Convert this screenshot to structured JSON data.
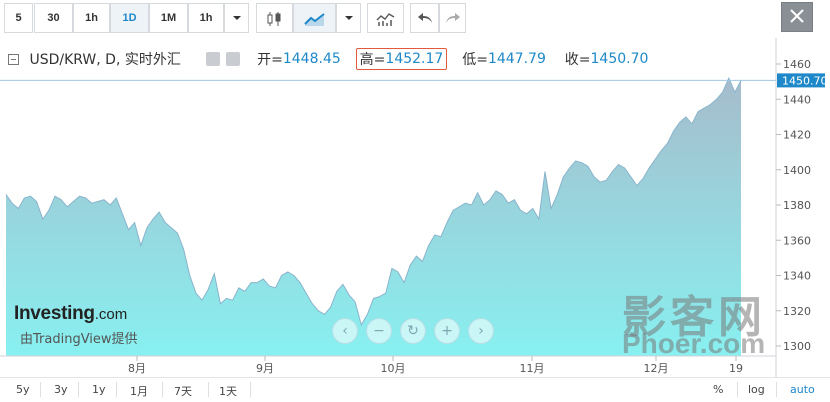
{
  "toolbar": {
    "intervals": [
      "5",
      "30",
      "1h",
      "1D",
      "1M",
      "1h"
    ],
    "active_interval": "1D",
    "icons": [
      "candlestick-icon",
      "line-chart-icon",
      "chevron-down-icon",
      "indicators-icon",
      "undo-icon",
      "redo-icon",
      "close-icon"
    ]
  },
  "legend": {
    "symbol": "USD/KRW, D, 实时外汇",
    "open_label": "开=",
    "open": "1448.45",
    "high_label": "高=",
    "high": "1452.17",
    "low_label": "低=",
    "low": "1447.79",
    "close_label": "收=",
    "close": "1450.70"
  },
  "chart_data": {
    "type": "area",
    "x_ticks": [
      "8月",
      "9月",
      "10月",
      "11月",
      "12月",
      "19"
    ],
    "y_ticks": [
      1300,
      1320,
      1340,
      1360,
      1380,
      1400,
      1420,
      1440,
      1460
    ],
    "ylim": [
      1296,
      1463
    ],
    "last_price": "1450.70",
    "values": [
      1386,
      1381,
      1378,
      1384,
      1385,
      1382,
      1372,
      1377,
      1385,
      1383,
      1379,
      1382,
      1385,
      1384,
      1381,
      1382,
      1383,
      1380,
      1384,
      1375,
      1366,
      1370,
      1357,
      1367,
      1372,
      1376,
      1370,
      1367,
      1364,
      1355,
      1340,
      1330,
      1326,
      1332,
      1341,
      1324,
      1327,
      1326,
      1333,
      1331,
      1336,
      1336,
      1338,
      1334,
      1333,
      1340,
      1342,
      1340,
      1336,
      1330,
      1324,
      1320,
      1318,
      1322,
      1331,
      1335,
      1329,
      1325,
      1312,
      1318,
      1327,
      1328,
      1330,
      1344,
      1342,
      1336,
      1346,
      1351,
      1348,
      1357,
      1363,
      1362,
      1370,
      1377,
      1379,
      1381,
      1380,
      1387,
      1380,
      1383,
      1388,
      1386,
      1381,
      1383,
      1377,
      1375,
      1378,
      1372,
      1399,
      1378,
      1386,
      1396,
      1401,
      1405,
      1404,
      1402,
      1396,
      1393,
      1394,
      1399,
      1403,
      1401,
      1396,
      1391,
      1395,
      1401,
      1406,
      1411,
      1415,
      1422,
      1427,
      1430,
      1426,
      1433,
      1435,
      1437,
      1440,
      1444,
      1452,
      1444,
      1450.7
    ],
    "grid": false,
    "legend_position": "top-left"
  },
  "branding": {
    "logo_main": "Investing",
    "logo_suffix": ".com",
    "powered_by": "由TradingView提供",
    "watermark_cn": "影客网",
    "watermark_en": "Phoer.com"
  },
  "bottom": {
    "ranges": [
      "5y",
      "3y",
      "1y",
      "1月",
      "7天",
      "1天"
    ],
    "percent": "%",
    "log": "log",
    "auto": "auto"
  },
  "colors": {
    "accent": "#1e88c9",
    "area_top": "#a6bccc",
    "area_bottom": "#88f0f0",
    "line": "#8ab4cc",
    "highlight_box": "#e15a3c"
  }
}
